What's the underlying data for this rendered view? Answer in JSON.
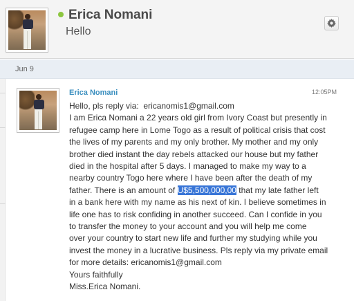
{
  "conversation": {
    "contact_name": "Erica Nomani",
    "subject": "Hello",
    "online_color": "#8cc63f",
    "settings_icon": "gear-icon"
  },
  "date_separator": {
    "label": "Jun 9"
  },
  "message": {
    "sender": "Erica Nomani",
    "time": "12:05PM",
    "lines": [
      "Hello, pls reply via:  ericanomis1@gmail.com",
      "I am Erica Nomani a 22 years old girl from Ivory Coast but presently in",
      "refugee camp here in Lome Togo as a result of political crisis that cost",
      "the lives of my parents and my only brother. My mother and my only",
      "brother died instant the day rebels attacked our house but my father",
      "died in the hospital after 5 days. I managed to make my way to a",
      "nearby country Togo here where I have been after the death of my",
      "father. There is an amount of ",
      "U$5,500,000,00",
      " that my late father left",
      "in a bank here with my name as his next of kin. I believe sometimes in",
      "life one has to risk confiding in another succeed. Can I confide in you",
      "to transfer the money to your account and you will help me come",
      "over your country to start new life and further my studying while you",
      "invest the money in a lucrative business. Pls reply via my private email",
      "for more details: ericanomis1@gmail.com",
      "Yours faithfully",
      "Miss.Erica Nomani."
    ],
    "highlight_color": "#3875d7"
  }
}
